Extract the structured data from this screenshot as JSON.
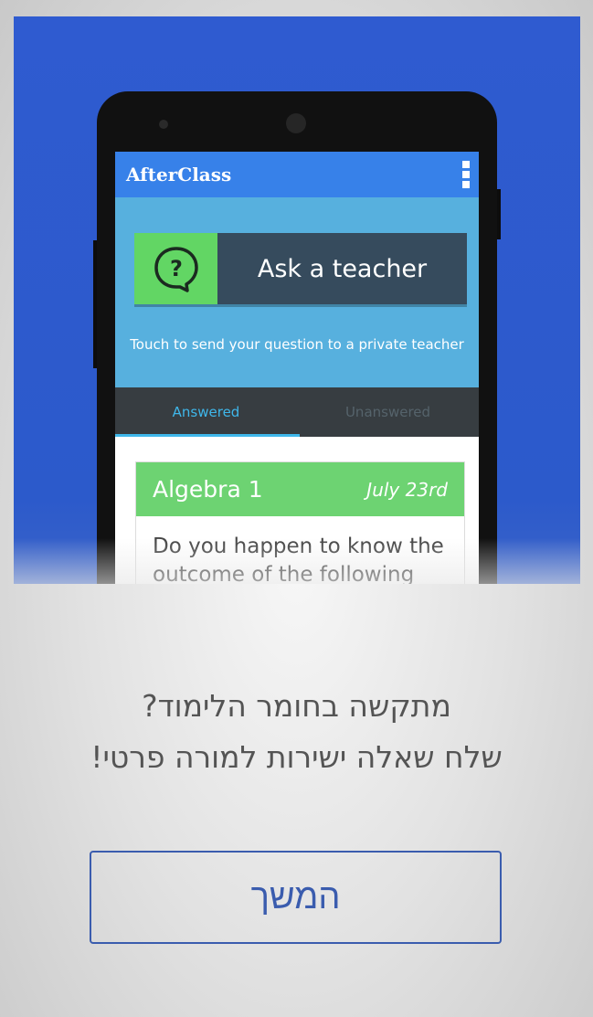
{
  "app": {
    "title": "AfterClass",
    "ask_button_label": "Ask a teacher",
    "hint": "Touch to send your question to a private teacher",
    "tabs": [
      {
        "label": "Answered",
        "active": true
      },
      {
        "label": "Unanswered",
        "active": false
      }
    ],
    "question_card": {
      "subject": "Algebra 1",
      "date": "July 23rd",
      "text": "Do you happen to know the outcome of the following"
    }
  },
  "promo": {
    "line1": "מתקשה בחומר הלימוד?",
    "line2": "שלח שאלה ישירות למורה פרטי!"
  },
  "continue_label": "המשך",
  "icons": {
    "question": "question-bubble-icon",
    "overflow": "overflow-menu-icon"
  },
  "colors": {
    "hero_blue": "#2f5bd0",
    "app_bar": "#3781e9",
    "panel_blue": "#57b0de",
    "ask_green": "#62d664",
    "ask_dark": "#364b5d",
    "tab_active": "#3fb7ea",
    "card_green": "#6dd372",
    "button_border": "#3a5cae"
  }
}
